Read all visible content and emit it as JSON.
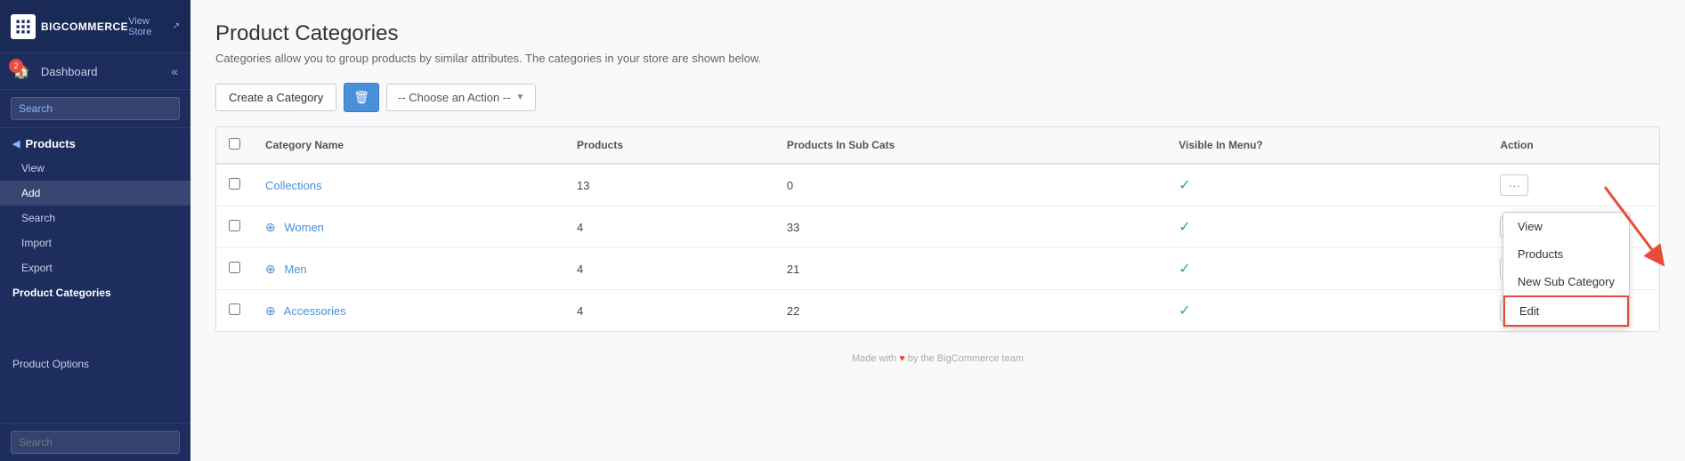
{
  "sidebar": {
    "brand": "BIGCOMMERCE",
    "view_store": "View Store",
    "dashboard": "Dashboard",
    "notification_count": "2",
    "search_top_placeholder": "Search",
    "search_bottom_placeholder": "Search",
    "products_section": "Products",
    "nav_items": [
      {
        "label": "View",
        "active": false
      },
      {
        "label": "Add",
        "active": true
      },
      {
        "label": "Search",
        "active": false
      },
      {
        "label": "Import",
        "active": false
      },
      {
        "label": "Export",
        "active": false
      }
    ],
    "product_categories": "Product Categories",
    "product_options": "Product Options"
  },
  "main": {
    "page_title": "Product Categories",
    "page_subtitle": "Categories allow you to group products by similar attributes. The categories in your store are shown below.",
    "toolbar": {
      "create_category": "Create a Category",
      "choose_action": "-- Choose an Action --"
    },
    "table": {
      "headers": [
        "",
        "Category Name",
        "Products",
        "Products In Sub Cats",
        "Visible In Menu?",
        "Action"
      ],
      "rows": [
        {
          "name": "Collections",
          "products": "13",
          "sub_cats": "0",
          "visible": true,
          "has_expand": false
        },
        {
          "name": "Women",
          "products": "4",
          "sub_cats": "33",
          "visible": true,
          "has_expand": true
        },
        {
          "name": "Men",
          "products": "4",
          "sub_cats": "21",
          "visible": true,
          "has_expand": true
        },
        {
          "name": "Accessories",
          "products": "4",
          "sub_cats": "22",
          "visible": true,
          "has_expand": true
        }
      ]
    },
    "dropdown_menu": {
      "items": [
        {
          "label": "View",
          "highlighted": false
        },
        {
          "label": "Products",
          "highlighted": false
        },
        {
          "label": "New Sub Category",
          "highlighted": false
        },
        {
          "label": "Edit",
          "highlighted": true
        }
      ]
    },
    "footer": "Made with ♥ by the BigCommerce team"
  }
}
